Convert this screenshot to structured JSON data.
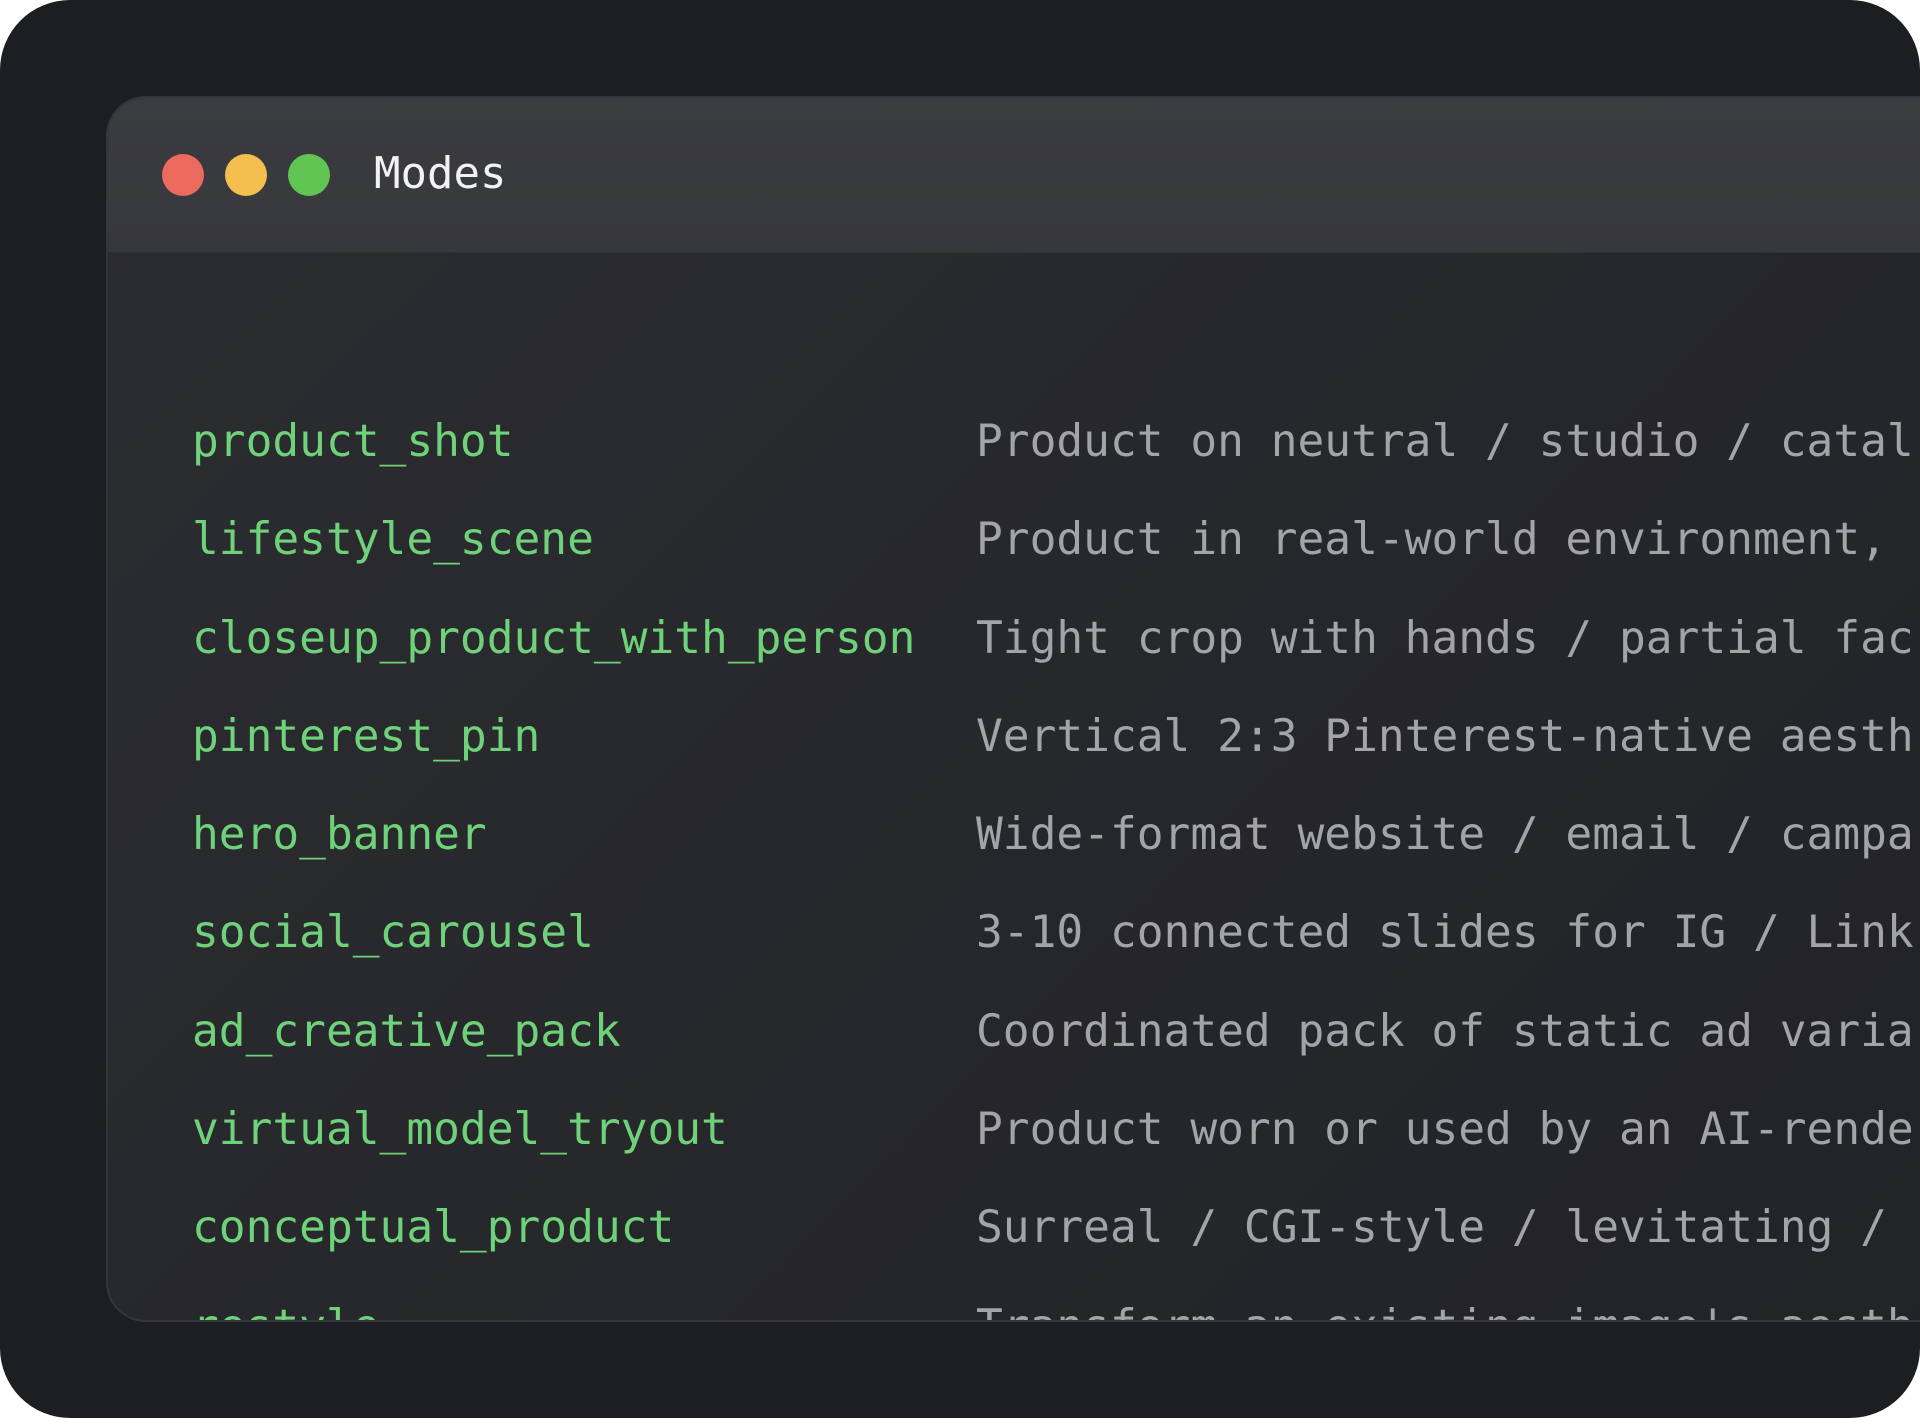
{
  "window": {
    "title": "Modes",
    "controls": {
      "close_color": "#ec6a5e",
      "minimize_color": "#f4bf4f",
      "maximize_color": "#61c554"
    }
  },
  "colors": {
    "mode_name": "#6fd27b",
    "mode_description": "#a3a4a7"
  },
  "modes": [
    {
      "name": "product_shot",
      "description": "Product on neutral / studio / catal"
    },
    {
      "name": "lifestyle_scene",
      "description": "Product in real-world environment,"
    },
    {
      "name": "closeup_product_with_person",
      "description": "Tight crop with hands / partial fac"
    },
    {
      "name": "pinterest_pin",
      "description": "Vertical 2:3 Pinterest-native aesth"
    },
    {
      "name": "hero_banner",
      "description": "Wide-format website / email / campa"
    },
    {
      "name": "social_carousel",
      "description": "3-10 connected slides for IG / Link"
    },
    {
      "name": "ad_creative_pack",
      "description": "Coordinated pack of static ad varia"
    },
    {
      "name": "virtual_model_tryout",
      "description": "Product worn or used by an AI-rende"
    },
    {
      "name": "conceptual_product",
      "description": "Surreal / CGI-style / levitating /"
    },
    {
      "name": "restyle",
      "description": "Transform an existing image's aesth"
    }
  ]
}
